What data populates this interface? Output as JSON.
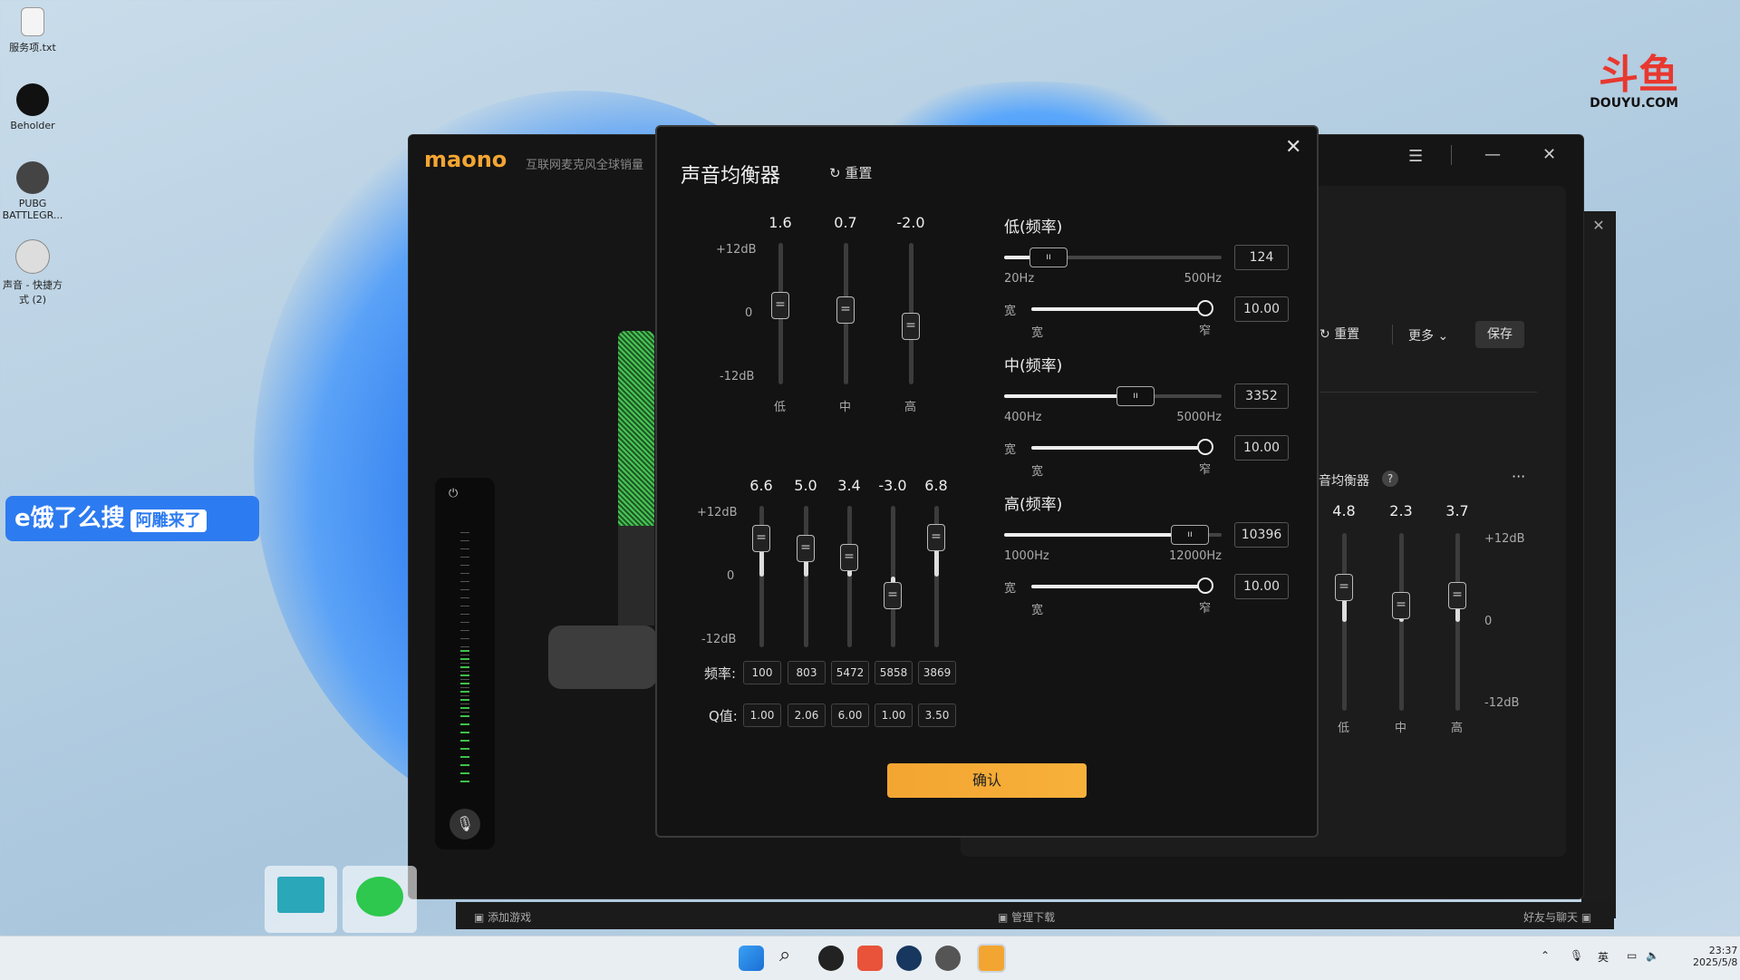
{
  "desktop": {
    "icons": [
      {
        "label": "服务项.txt",
        "icon": "text-file-icon"
      },
      {
        "label": "Beholder",
        "icon": "app-icon"
      },
      {
        "label": "PUBG BATTLEGR...",
        "icon": "game-icon"
      },
      {
        "label": "声音 - 快捷方式 (2)",
        "icon": "shortcut-icon"
      }
    ],
    "overlay_badge": {
      "main": "e饿了么搜",
      "sub": "阿雕来了"
    },
    "watermark": {
      "name": "斗鱼",
      "url": "DOUYU.COM"
    }
  },
  "app": {
    "brand": "maono",
    "subtitle": "互联网麦克风全球销量",
    "window_controls": [
      "menu-icon",
      "minimize-icon",
      "close-icon"
    ],
    "right_panel": {
      "reset_label": "重置",
      "more_label": "更多",
      "save_label": "保存",
      "eq_title": "音均衡器",
      "help": "?",
      "more_dots": "···",
      "values": [
        "4.8",
        "2.3",
        "3.7"
      ],
      "band_labels": [
        "低",
        "中",
        "高"
      ],
      "db_top": "+12dB",
      "db_mid": "0",
      "db_bottom": "-12dB"
    },
    "bottom_bar": {
      "add_game": "添加游戏",
      "manage_download": "管理下载",
      "friends_chat": "好友与聊天"
    }
  },
  "dialog": {
    "title": "声音均衡器",
    "reset_label": "重置",
    "confirm_label": "确认",
    "simple_eq": {
      "db_top": "+12dB",
      "db_mid": "0",
      "db_bottom": "-12dB",
      "bands": [
        {
          "label": "低",
          "value": "1.6",
          "gain": 1.6
        },
        {
          "label": "中",
          "value": "0.7",
          "gain": 0.7
        },
        {
          "label": "高",
          "value": "-2.0",
          "gain": -2.0
        }
      ]
    },
    "advanced_eq": {
      "db_top": "+12dB",
      "db_mid": "0",
      "db_bottom": "-12dB",
      "freq_label": "频率:",
      "q_label": "Q值:",
      "bands": [
        {
          "value": "6.6",
          "gain": 6.6,
          "freq": "100",
          "q": "1.00"
        },
        {
          "value": "5.0",
          "gain": 5.0,
          "freq": "803",
          "q": "2.06"
        },
        {
          "value": "3.4",
          "gain": 3.4,
          "freq": "5472",
          "q": "6.00"
        },
        {
          "value": "-3.0",
          "gain": -3.0,
          "freq": "5858",
          "q": "1.00"
        },
        {
          "value": "6.8",
          "gain": 6.8,
          "freq": "3869",
          "q": "3.50"
        }
      ]
    },
    "sections": [
      {
        "title": "低(频率)",
        "freq_value": "124",
        "freq_fraction": 0.2,
        "min": "20Hz",
        "max": "500Hz",
        "width_label": "宽",
        "wide_label": "宽",
        "narrow_label": "窄",
        "q_value": "10.00",
        "q_fraction": 1.0
      },
      {
        "title": "中(频率)",
        "freq_value": "3352",
        "freq_fraction": 0.6,
        "min": "400Hz",
        "max": "5000Hz",
        "width_label": "宽",
        "wide_label": "宽",
        "narrow_label": "窄",
        "q_value": "10.00",
        "q_fraction": 1.0
      },
      {
        "title": "高(频率)",
        "freq_value": "10396",
        "freq_fraction": 0.85,
        "min": "1000Hz",
        "max": "12000Hz",
        "width_label": "宽",
        "wide_label": "宽",
        "narrow_label": "窄",
        "q_value": "10.00",
        "q_fraction": 1.0
      }
    ]
  },
  "taskbar": {
    "tray_lang": "英",
    "time": "23:37",
    "date": "2025/5/8"
  },
  "colors": {
    "accent": "#f3a532",
    "dialog_bg": "#131313",
    "taskbar_bg": "#e9eef3"
  }
}
